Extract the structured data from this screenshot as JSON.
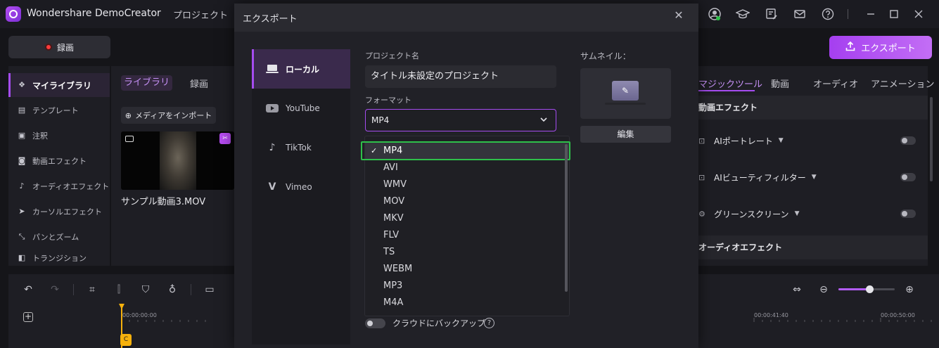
{
  "app": {
    "title": "Wondershare DemoCreator",
    "menu_project": "プロジェクト"
  },
  "toolbar": {
    "record_label": "録画",
    "export_label": "エクスポート"
  },
  "sidebar": {
    "items": [
      {
        "label": "マイライブラリ",
        "icon": "layers-icon"
      },
      {
        "label": "テンプレート",
        "icon": "template-icon"
      },
      {
        "label": "注釈",
        "icon": "annotation-icon"
      },
      {
        "label": "動画エフェクト",
        "icon": "effects-icon"
      },
      {
        "label": "オーディオエフェクト",
        "icon": "music-note-icon"
      },
      {
        "label": "カーソルエフェクト",
        "icon": "cursor-icon"
      },
      {
        "label": "パンとズーム",
        "icon": "pan-zoom-icon"
      },
      {
        "label": "トランジション",
        "icon": "transition-icon"
      }
    ]
  },
  "library": {
    "tab_library": "ライブラリ",
    "tab_record": "録画",
    "import_label": "メディアをインポート",
    "media_name": "サンプル動画3.MOV"
  },
  "right_panel": {
    "tabs": [
      "マジックツール",
      "動画",
      "オーディオ",
      "アニメーション"
    ],
    "section_video": "動画エフェクト",
    "rows": [
      "AIポートレート",
      "AIビューティフィルター",
      "グリーンスクリーン"
    ],
    "section_audio": "オーディオエフェクト"
  },
  "timeline": {
    "timecodes": [
      "00:00:00:00",
      "00:00:41:40",
      "00:00:50:00"
    ]
  },
  "export_dialog": {
    "title": "エクスポート",
    "destinations": [
      {
        "label": "ローカル",
        "icon": "laptop-icon"
      },
      {
        "label": "YouTube",
        "icon": "youtube-icon"
      },
      {
        "label": "TikTok",
        "icon": "tiktok-icon"
      },
      {
        "label": "Vimeo",
        "icon": "vimeo-icon"
      }
    ],
    "project_name_label": "プロジェクト名",
    "project_name_value": "タイトル未設定のプロジェクト",
    "format_label": "フォーマット",
    "format_value": "MP4",
    "format_options": [
      "MP4",
      "AVI",
      "WMV",
      "MOV",
      "MKV",
      "FLV",
      "TS",
      "WEBM",
      "MP3",
      "M4A"
    ],
    "thumbnail_label": "サムネイル：",
    "edit_label": "編集",
    "cloud_backup_label": "クラウドにバックアップ"
  }
}
